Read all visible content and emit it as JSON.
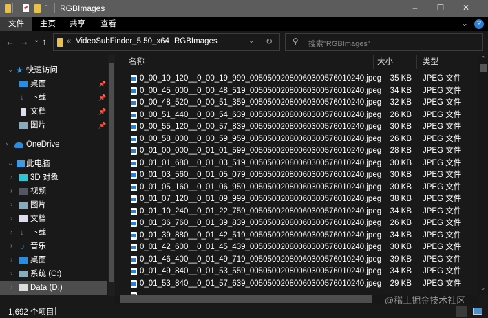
{
  "window": {
    "title": "RGBImages",
    "minimize": "–",
    "maximize": "☐",
    "close": "✕"
  },
  "ribbon": {
    "tabs": [
      "文件",
      "主页",
      "共享",
      "查看"
    ],
    "expand": "⌄",
    "help": "?"
  },
  "address": {
    "back": "←",
    "forward": "→",
    "recent": "⌄",
    "up": "↑",
    "overflow": "«",
    "crumbs": [
      "VideoSubFinder_5.50_x64",
      "RGBImages"
    ],
    "sep": "›",
    "dropdown": "⌄",
    "refresh": "↻"
  },
  "search": {
    "placeholder": "搜索\"RGBImages\""
  },
  "nav": {
    "quick_access": "快速访问",
    "quick_items": [
      "桌面",
      "下载",
      "文档",
      "图片"
    ],
    "onedrive": "OneDrive",
    "this_pc": "此电脑",
    "pc_items": [
      "3D 对象",
      "视频",
      "图片",
      "文档",
      "下载",
      "音乐",
      "桌面",
      "系统 (C:)",
      "Data (D:)"
    ]
  },
  "columns": {
    "name": "名称",
    "size": "大小",
    "type": "类型"
  },
  "files": [
    {
      "name": "0_00_10_120__0_00_19_999_00505002080060300576010240.jpeg",
      "size": "35 KB",
      "type": "JPEG 文件"
    },
    {
      "name": "0_00_45_000__0_00_48_519_00505002080060300576010240.jpeg",
      "size": "34 KB",
      "type": "JPEG 文件"
    },
    {
      "name": "0_00_48_520__0_00_51_359_00505002080060300576010240.jpeg",
      "size": "32 KB",
      "type": "JPEG 文件"
    },
    {
      "name": "0_00_51_440__0_00_54_639_00505002080060300576010240.jpeg",
      "size": "26 KB",
      "type": "JPEG 文件"
    },
    {
      "name": "0_00_55_120__0_00_57_839_00505002080060300576010240.jpeg",
      "size": "30 KB",
      "type": "JPEG 文件"
    },
    {
      "name": "0_00_58_000__0_00_59_959_00505002080060300576010240.jpeg",
      "size": "26 KB",
      "type": "JPEG 文件"
    },
    {
      "name": "0_01_00_000__0_01_01_599_00505002080060300576010240.jpeg",
      "size": "28 KB",
      "type": "JPEG 文件"
    },
    {
      "name": "0_01_01_680__0_01_03_519_00505002080060300576010240.jpeg",
      "size": "30 KB",
      "type": "JPEG 文件"
    },
    {
      "name": "0_01_03_560__0_01_05_079_00505002080060300576010240.jpeg",
      "size": "30 KB",
      "type": "JPEG 文件"
    },
    {
      "name": "0_01_05_160__0_01_06_959_00505002080060300576010240.jpeg",
      "size": "30 KB",
      "type": "JPEG 文件"
    },
    {
      "name": "0_01_07_120__0_01_09_999_00505002080060300576010240.jpeg",
      "size": "38 KB",
      "type": "JPEG 文件"
    },
    {
      "name": "0_01_10_240__0_01_22_759_00505002080060300576010240.jpeg",
      "size": "34 KB",
      "type": "JPEG 文件"
    },
    {
      "name": "0_01_36_760__0_01_39_839_00505002080060300576010240.jpeg",
      "size": "26 KB",
      "type": "JPEG 文件"
    },
    {
      "name": "0_01_39_880__0_01_42_519_00505002080060300576010240.jpeg",
      "size": "34 KB",
      "type": "JPEG 文件"
    },
    {
      "name": "0_01_42_600__0_01_45_439_00505002080060300576010240.jpeg",
      "size": "30 KB",
      "type": "JPEG 文件"
    },
    {
      "name": "0_01_46_400__0_01_49_719_00505002080060300576010240.jpeg",
      "size": "39 KB",
      "type": "JPEG 文件"
    },
    {
      "name": "0_01_49_840__0_01_53_559_00505002080060300576010240.jpeg",
      "size": "34 KB",
      "type": "JPEG 文件"
    },
    {
      "name": "0_01_53_840__0_01_57_639_00505002080060300576010240.jpeg",
      "size": "29 KB",
      "type": "JPEG 文件"
    }
  ],
  "status": {
    "count": "1,692 个项目"
  },
  "watermark": "@稀土掘金技术社区"
}
